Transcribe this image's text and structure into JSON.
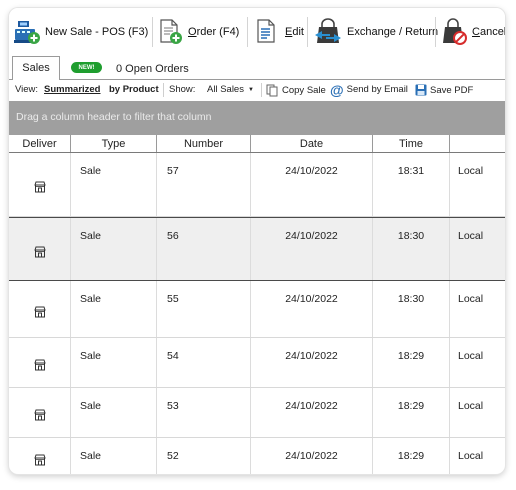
{
  "toolbar": {
    "new_sale": "New Sale - POS (F3)",
    "order": "rder (F4)",
    "order_hotkey": "O",
    "edit": "dit",
    "edit_hotkey": "E",
    "exchange": "Exchange / Return",
    "cancel": "ancel",
    "cancel_hotkey": "C"
  },
  "tabs": {
    "sales": "Sales",
    "new_badge": "NEW!",
    "open_orders": "0 Open Orders"
  },
  "options": {
    "view_label": "View:",
    "summarized": "Summarized",
    "by_product": "by Product",
    "show_label": "Show:",
    "show_value": "All Sales",
    "copy_sale": "Copy Sale",
    "send_email": "Send by Email",
    "save_pdf": "Save PDF"
  },
  "group_bar": {
    "text": "Drag a column header to filter that column"
  },
  "table": {
    "columns": [
      "Deliver",
      "Type",
      "Number",
      "Date",
      "Time",
      ""
    ],
    "rows": [
      {
        "type": "Sale",
        "number": "57",
        "date": "24/10/2022",
        "time": "18:31",
        "location": "Local"
      },
      {
        "type": "Sale",
        "number": "56",
        "date": "24/10/2022",
        "time": "18:30",
        "location": "Local",
        "selected": true
      },
      {
        "type": "Sale",
        "number": "55",
        "date": "24/10/2022",
        "time": "18:30",
        "location": "Local"
      },
      {
        "type": "Sale",
        "number": "54",
        "date": "24/10/2022",
        "time": "18:29",
        "location": "Local"
      },
      {
        "type": "Sale",
        "number": "53",
        "date": "24/10/2022",
        "time": "18:29",
        "location": "Local"
      },
      {
        "type": "Sale",
        "number": "52",
        "date": "24/10/2022",
        "time": "18:29",
        "location": "Local"
      }
    ]
  },
  "colors": {
    "new_badge": "#1f9e2f",
    "group_bar": "#9f9f9f",
    "selected_row": "#efefef",
    "icon_blue": "#2a6fb5",
    "icon_green": "#3aa545"
  },
  "icons": {
    "deliver": "store-icon",
    "new_sale": "cash-register-icon",
    "order": "order-document-icon",
    "edit": "edit-document-icon",
    "exchange": "exchange-bag-icon",
    "cancel": "cancel-bag-icon"
  }
}
